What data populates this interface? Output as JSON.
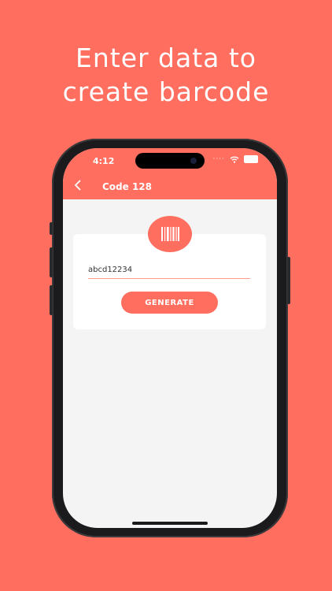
{
  "headline": {
    "line1": "Enter data to",
    "line2": "create barcode"
  },
  "status_bar": {
    "time": "4:12"
  },
  "header": {
    "back_icon": "chevron-left-icon",
    "title": "Code 128"
  },
  "form": {
    "badge_icon": "barcode-icon",
    "input_value": "abcd12234",
    "generate_label": "GENERATE"
  },
  "colors": {
    "accent": "#FF6E5F",
    "screen_bg": "#F4F4F4"
  }
}
